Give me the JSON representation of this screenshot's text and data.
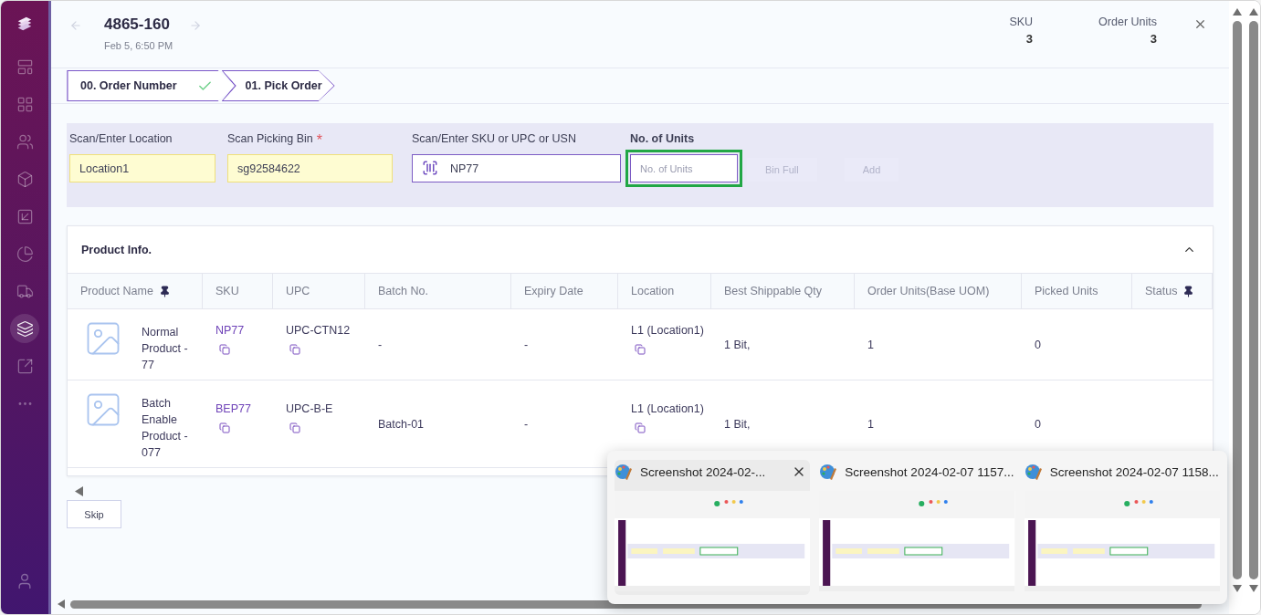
{
  "sidebar": {
    "items": [
      {
        "selected": false
      },
      {
        "selected": false
      },
      {
        "selected": false
      },
      {
        "selected": false
      },
      {
        "selected": false
      },
      {
        "selected": false
      },
      {
        "selected": false
      },
      {
        "selected": true
      },
      {
        "selected": false
      },
      {
        "selected": false
      }
    ]
  },
  "header": {
    "title": "4865-160",
    "date": "Feb 5, 6:50 PM",
    "stats": [
      {
        "label": "SKU",
        "value": "3"
      },
      {
        "label": "Order Units",
        "value": "3"
      }
    ]
  },
  "steps": [
    {
      "label": "00. Order Number",
      "done": true
    },
    {
      "label": "01. Pick Order",
      "done": false
    }
  ],
  "form": {
    "fields": [
      {
        "kind": "text",
        "label": "Scan/Enter Location",
        "value": "Location1",
        "required": false,
        "filled": true,
        "focused": false
      },
      {
        "kind": "text",
        "label": "Scan Picking Bin",
        "value": "sg92584622",
        "required": true,
        "filled": true,
        "focused": false
      },
      {
        "kind": "scan",
        "label": "Scan/Enter SKU or UPC or USN",
        "value": "NP77",
        "required": false,
        "filled": false,
        "focused": false
      },
      {
        "kind": "text",
        "label": "No. of Units",
        "placeholder": "No. of Units",
        "required": false,
        "filled": false,
        "focused": true
      }
    ],
    "required_mark": "*",
    "buttons": [
      {
        "label": "Bin Full",
        "disabled": true
      },
      {
        "label": "Add",
        "disabled": true
      }
    ]
  },
  "product_info": {
    "title": "Product Info.",
    "expanded": true,
    "columns": [
      {
        "label": "Product Name",
        "pinned": true
      },
      {
        "label": "SKU",
        "pinned": false
      },
      {
        "label": "UPC",
        "pinned": false
      },
      {
        "label": "Batch No.",
        "pinned": false
      },
      {
        "label": "Expiry Date",
        "pinned": false
      },
      {
        "label": "Location",
        "pinned": false
      },
      {
        "label": "Best Shippable Qty",
        "pinned": false
      },
      {
        "label": "Order Units(Base UOM)",
        "pinned": false
      },
      {
        "label": "Picked Units",
        "pinned": false
      },
      {
        "label": "Status",
        "pinned": true
      }
    ],
    "rows": [
      {
        "name": "Normal Product - 77",
        "sku": "NP77",
        "upc": "UPC-CTN12",
        "batch": "-",
        "expiry": "-",
        "location": "L1 (Location1)",
        "best_qty": "1 Bit,",
        "order_units": "1",
        "picked_units": "0"
      },
      {
        "name": "Batch Enable Product - 077",
        "sku": "BEP77",
        "upc": "UPC-B-E",
        "batch": "Batch-01",
        "expiry": "-",
        "location": "L1 (Location1)",
        "best_qty": "1 Bit,",
        "order_units": "1",
        "picked_units": "0"
      }
    ]
  },
  "skip_button": "Skip",
  "window_previews": [
    {
      "title": "Screenshot 2024-02-...",
      "hovered": true
    },
    {
      "title": "Screenshot 2024-02-07 1157...",
      "hovered": false
    },
    {
      "title": "Screenshot 2024-02-07 1158...",
      "hovered": false
    }
  ]
}
